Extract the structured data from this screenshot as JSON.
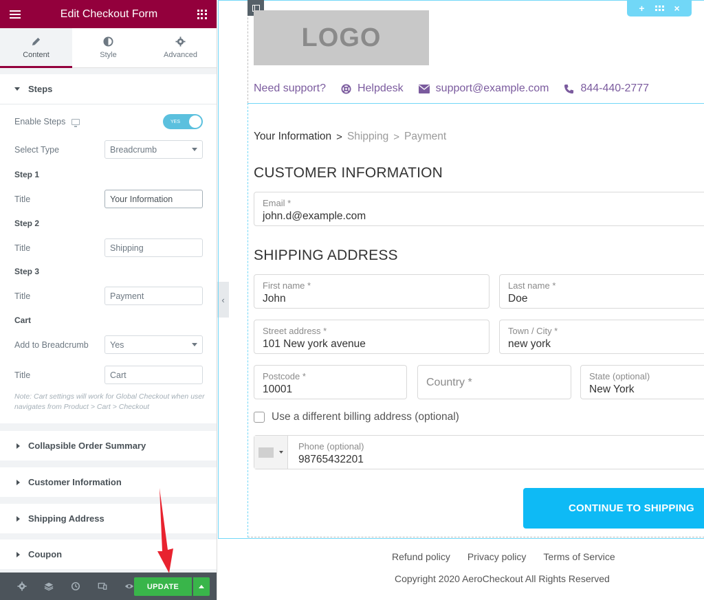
{
  "panel": {
    "title": "Edit Checkout Form",
    "tabs": [
      {
        "label": "Content",
        "icon": "pencil-icon"
      },
      {
        "label": "Style",
        "icon": "half-circle-icon"
      },
      {
        "label": "Advanced",
        "icon": "gear-icon"
      }
    ],
    "steps_section": {
      "title": "Steps",
      "enable_steps_label": "Enable Steps",
      "toggle_text": "YES",
      "select_type_label": "Select Type",
      "select_type_value": "Breadcrumb",
      "step1_label": "Step 1",
      "step1_title_label": "Title",
      "step1_title_value": "Your Information",
      "step2_label": "Step 2",
      "step2_title_label": "Title",
      "step2_title_value": "Shipping",
      "step3_label": "Step 3",
      "step3_title_label": "Title",
      "step3_title_value": "Payment",
      "cart_label": "Cart",
      "add_breadcrumb_label": "Add to Breadcrumb",
      "add_breadcrumb_value": "Yes",
      "cart_title_label": "Title",
      "cart_title_value": "Cart",
      "note": "Note: Cart settings will work for Global Checkout when user navigates from Product > Cart > Checkout"
    },
    "collapsed_sections": [
      "Collapsible Order Summary",
      "Customer Information",
      "Shipping Address",
      "Coupon"
    ],
    "footer": {
      "update_label": "UPDATE"
    }
  },
  "preview": {
    "logo_text": "LOGO",
    "support": {
      "need_support": "Need support?",
      "helpdesk": "Helpdesk",
      "email": "support@example.com",
      "phone": "844-440-2777"
    },
    "breadcrumb": {
      "current": "Your Information",
      "step2": "Shipping",
      "step3": "Payment",
      "separator": ">"
    },
    "customer_heading": "CUSTOMER INFORMATION",
    "email_label": "Email *",
    "email_value": "john.d@example.com",
    "shipping_heading": "SHIPPING ADDRESS",
    "first_name_label": "First name *",
    "first_name_value": "John",
    "last_name_label": "Last name *",
    "last_name_value": "Doe",
    "street_label": "Street address *",
    "street_value": "101 New york avenue",
    "city_label": "Town / City *",
    "city_value": "new york",
    "postcode_label": "Postcode *",
    "postcode_value": "10001",
    "country_placeholder": "Country *",
    "state_label": "State (optional)",
    "state_value": "New York",
    "billing_label": "Use a different billing address (optional)",
    "phone_label": "Phone (optional)",
    "phone_value": "98765432201",
    "continue_label": "CONTINUE TO SHIPPING"
  },
  "footer": {
    "links": [
      "Refund policy",
      "Privacy policy",
      "Terms of Service"
    ],
    "copyright": "Copyright 2020 AeroCheckout All Rights Reserved"
  },
  "colors": {
    "panel_header": "#93003c",
    "accent_blue": "#0ebaf5",
    "update_green": "#39b54a",
    "support_purple": "#7b5b9e"
  }
}
